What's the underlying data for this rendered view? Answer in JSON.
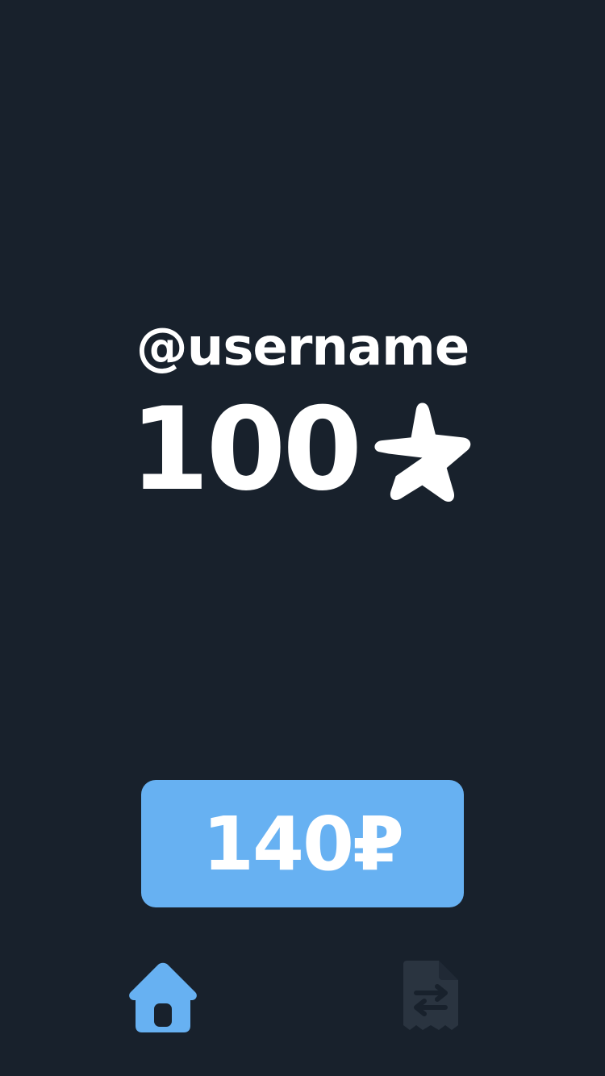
{
  "profile": {
    "username": "@username",
    "balance": "100",
    "balance_icon": "star-icon"
  },
  "purchase": {
    "price_label": "140₽"
  },
  "nav": {
    "items": [
      {
        "name": "home",
        "icon": "home-icon",
        "active": true
      },
      {
        "name": "transactions",
        "icon": "receipt-exchange-icon",
        "active": false
      }
    ],
    "active_color": "#67b1f2",
    "inactive_color": "#2a3440"
  },
  "colors": {
    "background": "#18212c",
    "accent": "#67b1f2",
    "text": "#ffffff"
  }
}
